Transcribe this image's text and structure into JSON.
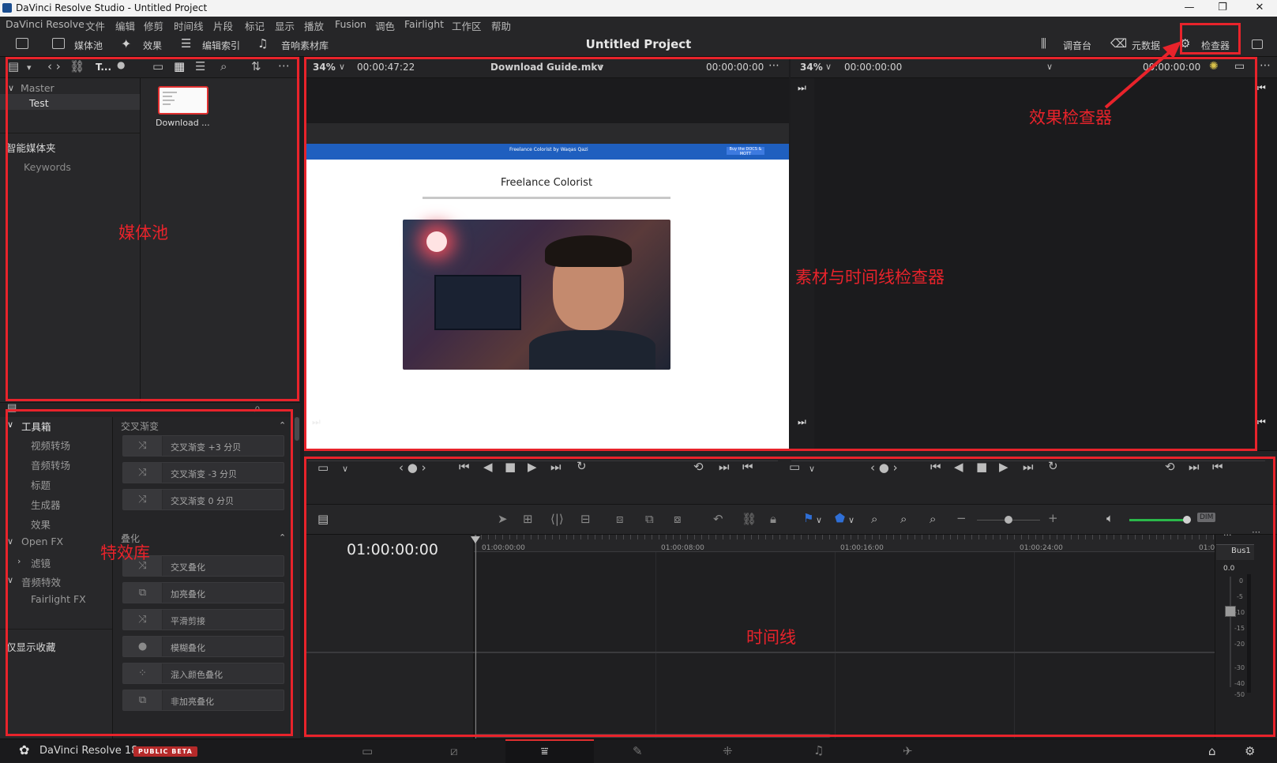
{
  "window": {
    "title": "DaVinci Resolve Studio - Untitled Project",
    "minimize": "—",
    "restore": "❐",
    "close": "✕"
  },
  "menu": [
    "DaVinci Resolve",
    "文件",
    "编辑",
    "修剪",
    "时间线",
    "片段",
    "标记",
    "显示",
    "播放",
    "Fusion",
    "调色",
    "Fairlight",
    "工作区",
    "帮助"
  ],
  "toolbar": {
    "left": [
      {
        "label": "媒体池",
        "icon": "media-pool-icon"
      },
      {
        "label": "效果",
        "icon": "effects-wand-icon"
      },
      {
        "label": "编辑索引",
        "icon": "edit-index-icon"
      },
      {
        "label": "音响素材库",
        "icon": "sound-library-icon"
      }
    ],
    "project_title": "Untitled Project",
    "right": [
      {
        "label": "调音台",
        "icon": "mixer-icon"
      },
      {
        "label": "元数据",
        "icon": "metadata-icon"
      },
      {
        "label": "检查器",
        "icon": "inspector-icon"
      }
    ]
  },
  "media_pool": {
    "bar_label": "T...",
    "tree": {
      "master": "Master",
      "bin": "Test",
      "smart_bins": "智能媒体夹",
      "keywords": "Keywords"
    },
    "clip_name": "Download ..."
  },
  "effects": {
    "toolbox": "工具箱",
    "toolbox_items": [
      "视频转场",
      "音频转场",
      "标题",
      "生成器",
      "效果"
    ],
    "openfx": "Open FX",
    "openfx_items": [
      "滤镜"
    ],
    "audio_fx": "音频特效",
    "audio_fx_items": [
      "Fairlight FX"
    ],
    "favorites_only": "仅显示收藏",
    "group1_title": "交叉渐变",
    "group1": [
      "交叉渐变 +3 分贝",
      "交叉渐变 -3 分贝",
      "交叉渐变 0 分贝"
    ],
    "group2_title": "叠化",
    "group2": [
      "交叉叠化",
      "加亮叠化",
      "平滑剪接",
      "模糊叠化",
      "混入颜色叠化",
      "非加亮叠化"
    ]
  },
  "source_viewer": {
    "zoom": "34%",
    "duration": "00:00:47:22",
    "clip": "Download Guide.mkv",
    "timecode": "00:00:00:00"
  },
  "source_frame": {
    "page_title": "Freelance Colorist",
    "nav_brand": "Freelance Colorist by Waqas Qazi",
    "nav_button": "Buy the DOCS & MOTT"
  },
  "timeline_viewer": {
    "zoom": "34%",
    "timecode_left": "00:00:00:00",
    "timecode_right": "00:00:00:00"
  },
  "timeline": {
    "current_timecode": "01:00:00:00",
    "ruler": [
      "01:00:00:00",
      "01:00:08:00",
      "01:00:16:00",
      "01:00:24:00",
      "01:0"
    ],
    "bus": "Bus1",
    "meter_value": "0.0",
    "meter_scale": [
      "0",
      "-5",
      "-10",
      "-15",
      "-20",
      "-30",
      "-40",
      "-50"
    ],
    "dim": "DIM",
    "more": "..."
  },
  "statusbar": {
    "app": "DaVinci Resolve 18",
    "badge": "PUBLIC BETA",
    "pages": [
      "media-page-icon",
      "cut-page-icon",
      "edit-page-icon",
      "fusion-page-icon",
      "color-page-icon",
      "fairlight-page-icon",
      "deliver-page-icon"
    ],
    "active_page": 2
  },
  "annotations": {
    "media_pool": "媒体池",
    "effects_library": "特效库",
    "viewer": "素材与时间线检查器",
    "inspector": "效果检查器",
    "timeline": "时间线"
  },
  "colors": {
    "annotation": "#e8232b",
    "active_page": "#e03030",
    "accent_blue": "#2f6fd6",
    "volume_green": "#2bb84a"
  }
}
